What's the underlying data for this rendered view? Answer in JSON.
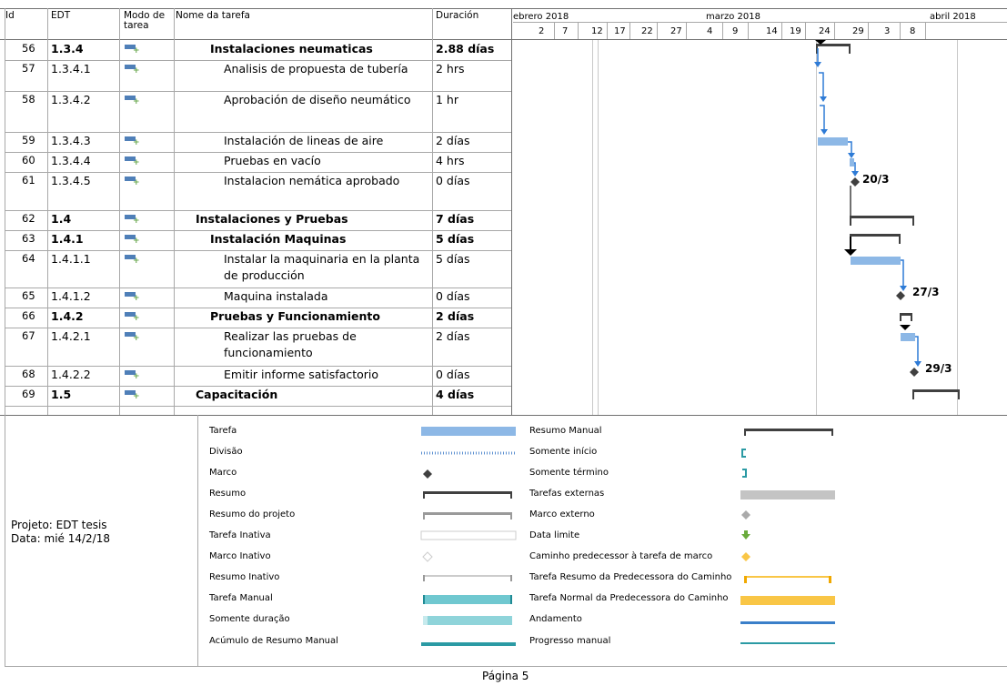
{
  "columns": {
    "id": "Id",
    "edt": "EDT",
    "mode": "Modo de\ntarea",
    "name": "Nome da tarefa",
    "duration": "Duración"
  },
  "timescale": {
    "months": [
      "ebrero 2018",
      "marzo 2018",
      "abril 2018"
    ],
    "days": [
      "2",
      "7",
      "12",
      "17",
      "22",
      "27",
      "4",
      "9",
      "14",
      "19",
      "24",
      "29",
      "3",
      "8"
    ]
  },
  "rows": [
    {
      "id": "56",
      "edt": "1.3.4",
      "name": "Instalaciones neumaticas",
      "duration": "2.88 días",
      "bold": true,
      "indent": 1
    },
    {
      "id": "57",
      "edt": "1.3.4.1",
      "name": "Analisis de propuesta de tubería",
      "duration": "2 hrs",
      "bold": false,
      "indent": 2
    },
    {
      "id": "58",
      "edt": "1.3.4.2",
      "name": "Aprobación de diseño neumático",
      "duration": "1 hr",
      "bold": false,
      "indent": 2
    },
    {
      "id": "59",
      "edt": "1.3.4.3",
      "name": "Instalación de lineas de aire",
      "duration": "2 días",
      "bold": false,
      "indent": 2
    },
    {
      "id": "60",
      "edt": "1.3.4.4",
      "name": "Pruebas en vacío",
      "duration": "4 hrs",
      "bold": false,
      "indent": 2
    },
    {
      "id": "61",
      "edt": "1.3.4.5",
      "name": "Instalacion nemática aprobado",
      "duration": "0 días",
      "bold": false,
      "indent": 2
    },
    {
      "id": "62",
      "edt": "1.4",
      "name": "Instalaciones y Pruebas",
      "duration": "7 días",
      "bold": true,
      "indent": 0
    },
    {
      "id": "63",
      "edt": "1.4.1",
      "name": "Instalación Maquinas",
      "duration": "5 días",
      "bold": true,
      "indent": 1
    },
    {
      "id": "64",
      "edt": "1.4.1.1",
      "name": "Instalar la maquinaria en la planta",
      "name2": "de producción",
      "duration": "5 días",
      "bold": false,
      "indent": 2
    },
    {
      "id": "65",
      "edt": "1.4.1.2",
      "name": "Maquina instalada",
      "duration": "0 días",
      "bold": false,
      "indent": 2
    },
    {
      "id": "66",
      "edt": "1.4.2",
      "name": "Pruebas y Funcionamiento",
      "duration": "2 días",
      "bold": true,
      "indent": 1
    },
    {
      "id": "67",
      "edt": "1.4.2.1",
      "name": "Realizar las pruebas de",
      "name2": "funcionamiento",
      "duration": "2 días",
      "bold": false,
      "indent": 2
    },
    {
      "id": "68",
      "edt": "1.4.2.2",
      "name": "Emitir informe satisfactorio",
      "duration": "0 días",
      "bold": false,
      "indent": 2
    },
    {
      "id": "69",
      "edt": "1.5",
      "name": "Capacitación",
      "duration": "4 días",
      "bold": true,
      "indent": 0
    }
  ],
  "milestone_labels": [
    "20/3",
    "27/3",
    "29/3"
  ],
  "project": {
    "name": "Projeto: EDT tesis",
    "date": "Data: mié 14/2/18"
  },
  "legend_left": [
    "Tarefa",
    "Divisão",
    "Marco",
    "Resumo",
    "Resumo do projeto",
    "Tarefa Inativa",
    "Marco Inativo",
    "Resumo Inativo",
    "Tarefa Manual",
    "Somente duração",
    "Acúmulo de Resumo Manual"
  ],
  "legend_right": [
    "Resumo Manual",
    "Somente início",
    "Somente término",
    "Tarefas externas",
    "Marco externo",
    "Data limite",
    "Caminho predecessor à tarefa de marco",
    "Tarefa Resumo da Predecessora do Caminho",
    "Tarefa Normal da Predecessora do Caminho",
    "Andamento",
    "Progresso manual"
  ],
  "page": "Página 5",
  "colors": {
    "task": "#8db8e6",
    "summary": "#404040",
    "link": "#2e7bd6",
    "manual": "#70c8d0",
    "path": "#f9c646"
  }
}
